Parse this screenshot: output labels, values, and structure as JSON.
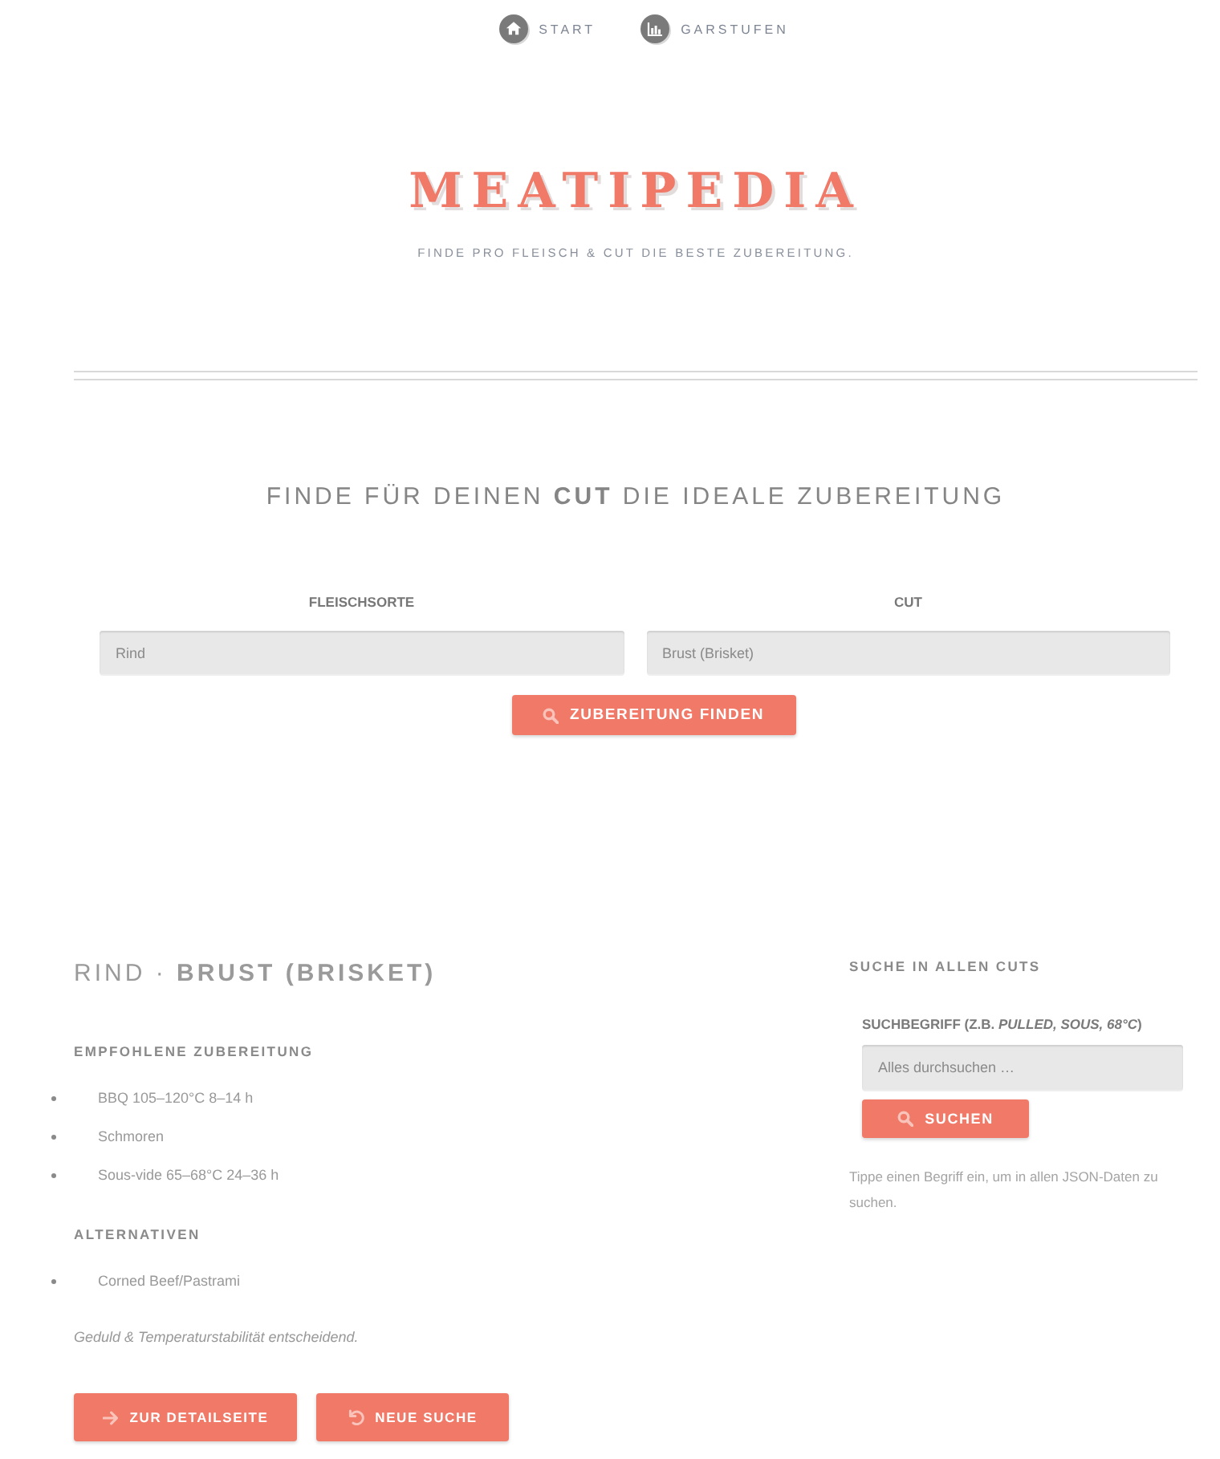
{
  "nav": [
    "START",
    "GARSTUFEN"
  ],
  "header": {
    "logo": "MEATIPEDIA",
    "tagline": "FINDE PRO FLEISCH & CUT DIE BESTE ZUBEREITUNG."
  },
  "finder": {
    "heading": "FINDE FÜR DEINEN **CUT** DIE IDEALE ZUBEREITUNG",
    "fields": [
      {
        "label": "FLEISCHSORTE",
        "value": "Rind"
      },
      {
        "label": "CUT",
        "value": "Brust (Brisket)"
      }
    ],
    "button": "ZUBEREITUNG FINDEN"
  },
  "result": {
    "title": "RIND · **BRUST (BRISKET)**",
    "sections": [
      {
        "heading": "EMPFOHLENE ZUBEREITUNG",
        "items": [
          "BBQ 105–120°C 8–14 h",
          "Schmoren",
          "Sous-vide 65–68°C 24–36 h"
        ]
      },
      {
        "heading": "ALTERNATIVEN",
        "items": [
          "Corned Beef/Pastrami"
        ]
      }
    ],
    "note": "Geduld & Temperaturstabilität entscheidend.",
    "actions": [
      "ZUR DETAILSEITE",
      "NEUE SUCHE"
    ]
  },
  "search": {
    "heading": "SUCHE IN ALLEN CUTS",
    "label": "SUCHBEGRIFF (Z.B. *PULLED, SOUS, 68°C*)",
    "placeholder": "Alles durchsuchen …",
    "button": "SUCHEN",
    "hint": "Tippe einen Begriff ein, um in allen JSON-Daten zu suchen."
  }
}
